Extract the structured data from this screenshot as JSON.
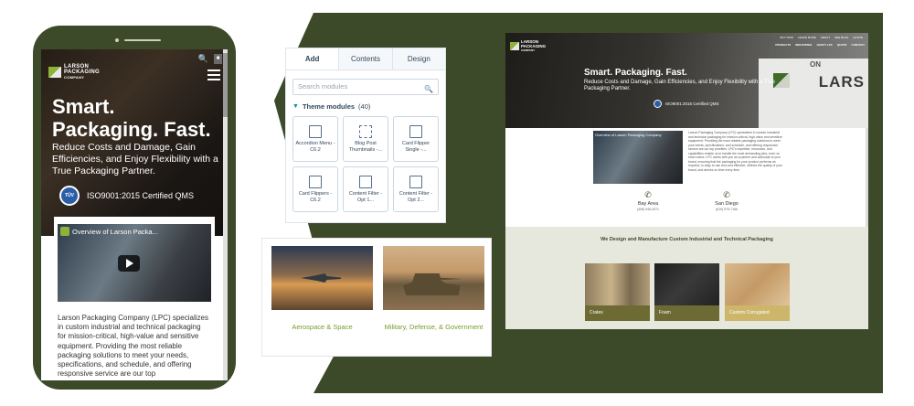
{
  "colors": {
    "accent_green": "#3c4a2a",
    "logo_green": "#8fb33a",
    "link_green": "#7a9a2c",
    "band_bg": "#e6e8dd"
  },
  "mobile": {
    "logo": [
      "LARSON",
      "PACKAGING",
      "COMPANY"
    ],
    "hero_title": "Smart. Packaging. Fast.",
    "hero_subtitle": "Reduce Costs and Damage, Gain Efficiencies, and Enjoy Flexibility with a True Packaging Partner.",
    "cert_text": "ISO9001:2015 Certified QMS",
    "tuv_badge": "TÜV",
    "video_title": "Overview of Larson Packa...",
    "body_text": "Larson Packaging Company (LPC) specializes in custom industrial and technical packaging for mission-critical, high-value and sensitive equipment. Providing the most reliable packaging solutions to meet your needs, specifications, and schedule, and offering responsive service are our top"
  },
  "editor": {
    "tabs": [
      "Add",
      "Contents",
      "Design"
    ],
    "search_placeholder": "Search modules",
    "section_label": "Theme modules",
    "section_count": "(40)",
    "modules": [
      {
        "label": "Accordion Menu - C6.2",
        "icon": "accordion-icon"
      },
      {
        "label": "Blog Post Thumbnails -...",
        "icon": "grid-icon"
      },
      {
        "label": "Card Flipper Single -...",
        "icon": "flip-icon"
      },
      {
        "label": "Card Flippers - C6.2",
        "icon": "flip-icon"
      },
      {
        "label": "Content Filter - Opt 1...",
        "icon": "filter-icon"
      },
      {
        "label": "Content Filter - Opt 2...",
        "icon": "filter-icon"
      }
    ]
  },
  "categories": [
    {
      "label": "Aerospace & Space"
    },
    {
      "label": "Military, Defense, & Government"
    }
  ],
  "desktop": {
    "logo": [
      "LARSON",
      "PACKAGING",
      "COMPANY"
    ],
    "topbar": [
      "BUY NOW",
      "LEARN MORE",
      "ABOUT",
      "SEE BLOG",
      "QUOTE"
    ],
    "nav": [
      "PRODUCTS",
      "INDUSTRIES",
      "ABOUT LPC",
      "QUOTE",
      "CONTACT"
    ],
    "truck_text": "LARS",
    "truck_text_back": "ON",
    "hero_title": "Smart. Packaging. Fast.",
    "hero_subtitle": "Reduce Costs and Damage, Gain Efficiencies, and Enjoy Flexibility with a True Packaging Partner.",
    "cert_text": "ISO9001:2015 Certified QMS",
    "video_title": "Overview of Larson Packaging Company",
    "intro_text": "Larson Packaging Company (LPC) specializes in custom industrial and technical packaging for mission-critical, high-value and sensitive equipment. Providing the most reliable packaging solutions to meet your needs, specifications, and schedule, and offering responsive service are our top priorities. LPC's expertise, resources, and capabilities enable us to handle the most demanding jobs, even on short notice. LPC works with you as a partner and advocate of your brand, ensuring that the packaging for your product performs as required, is easy to use and cost effective, reflects the quality of your brand, and arrives on time every time.",
    "contacts": [
      {
        "name": "Bay Area",
        "number": "(408) 946-4971"
      },
      {
        "name": "San Diego",
        "number": "(619) 579-7166"
      }
    ],
    "band_title": "We Design and Manufacture Custom Industrial and Technical Packaging",
    "tiles": [
      {
        "label": "Crates"
      },
      {
        "label": "Foam"
      },
      {
        "label": "Custom Corrugated"
      }
    ]
  }
}
